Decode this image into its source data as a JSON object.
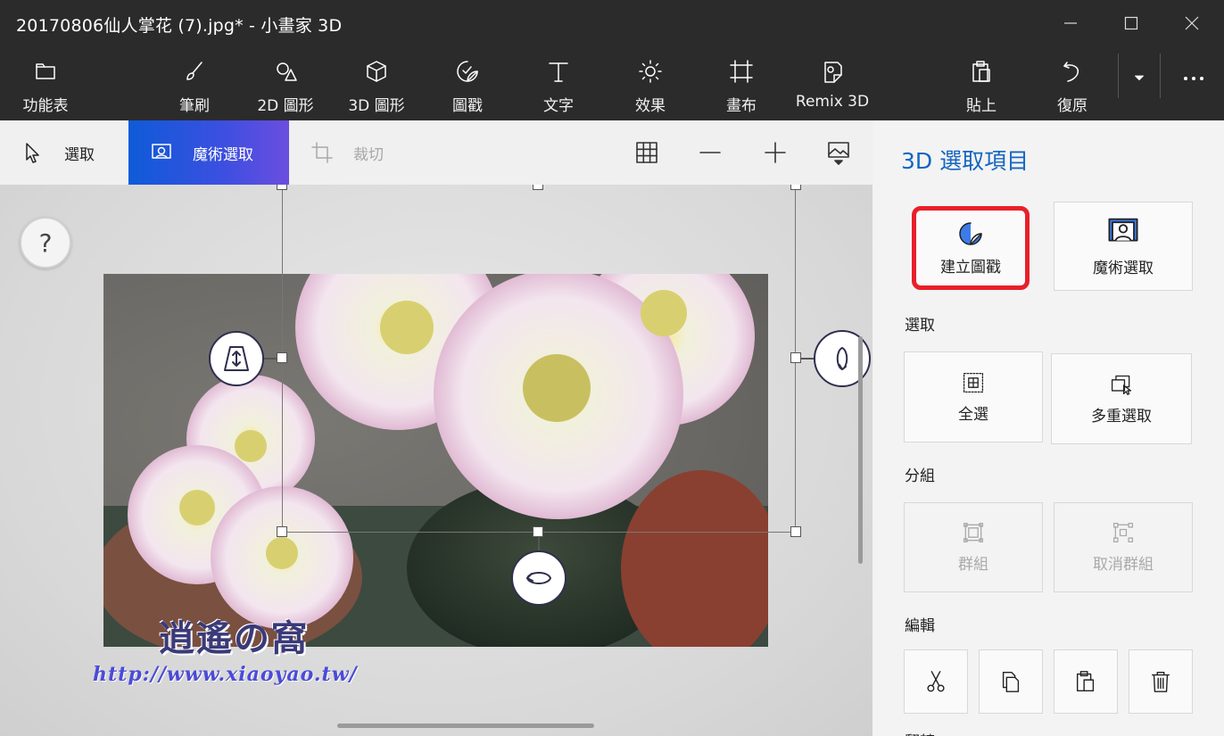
{
  "window": {
    "title": "20170806仙人掌花 (7).jpg* - 小畫家 3D"
  },
  "toolbar": {
    "menu": "功能表",
    "brush": "筆刷",
    "shapes2d": "2D 圖形",
    "shapes3d": "3D 圖形",
    "stickers": "圖戳",
    "text": "文字",
    "effects": "效果",
    "canvas": "畫布",
    "remix": "Remix 3D",
    "paste": "貼上",
    "undo": "復原"
  },
  "subbar": {
    "select": "選取",
    "magic_select": "魔術選取",
    "crop": "裁切"
  },
  "canvas": {
    "help": "?",
    "watermark_title": "逍遙の窩",
    "watermark_url": "http://www.xiaoyao.tw/"
  },
  "panel": {
    "title": "3D 選取項目",
    "make_sticker": "建立圖戳",
    "magic_select": "魔術選取",
    "section_select": "選取",
    "select_all": "全選",
    "multi_select": "多重選取",
    "section_group": "分組",
    "group": "群組",
    "ungroup": "取消群組",
    "section_edit": "編輯",
    "section_next": "翻轉"
  },
  "colors": {
    "accent": "#1565c0",
    "highlight": "#e8202a",
    "magic_gradient_start": "#0e5bd8",
    "magic_gradient_end": "#6b4ee0"
  }
}
